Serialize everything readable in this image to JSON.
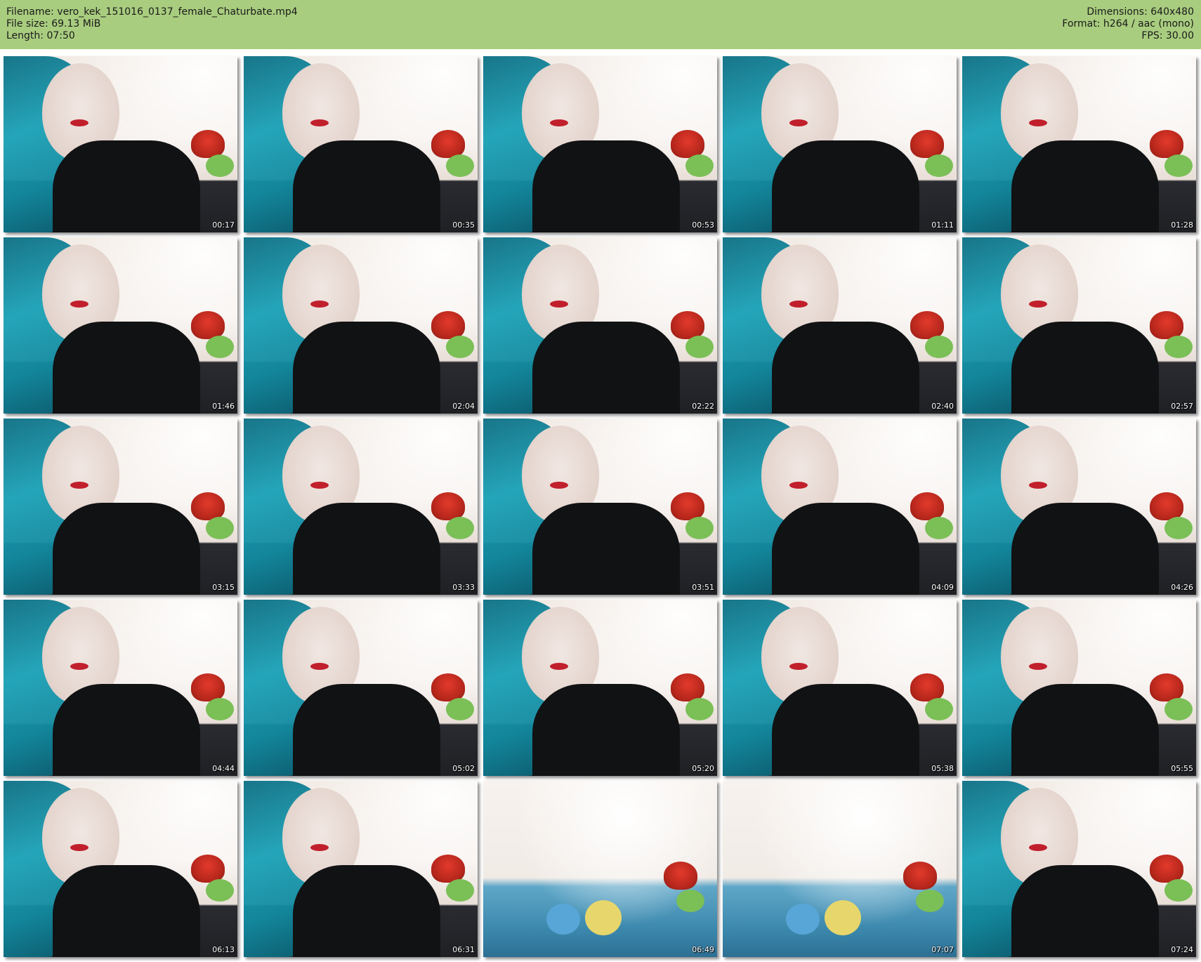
{
  "header": {
    "filename": "Filename: vero_kek_151016_0137_female_Chaturbate.mp4",
    "file_size": "File size: 69.13 MiB",
    "length": "Length: 07:50",
    "dimensions": "Dimensions: 640x480",
    "format": "Format: h264 / aac (mono)",
    "fps": "FPS: 30.00"
  },
  "thumbnails": [
    {
      "time": "00:17"
    },
    {
      "time": "00:35"
    },
    {
      "time": "00:53"
    },
    {
      "time": "01:11"
    },
    {
      "time": "01:28"
    },
    {
      "time": "01:46"
    },
    {
      "time": "02:04"
    },
    {
      "time": "02:22"
    },
    {
      "time": "02:40"
    },
    {
      "time": "02:57"
    },
    {
      "time": "03:15"
    },
    {
      "time": "03:33"
    },
    {
      "time": "03:51"
    },
    {
      "time": "04:09"
    },
    {
      "time": "04:26"
    },
    {
      "time": "04:44"
    },
    {
      "time": "05:02"
    },
    {
      "time": "05:20"
    },
    {
      "time": "05:38"
    },
    {
      "time": "05:55"
    },
    {
      "time": "06:13"
    },
    {
      "time": "06:31"
    },
    {
      "time": "06:49"
    },
    {
      "time": "07:07"
    },
    {
      "time": "07:24"
    }
  ]
}
